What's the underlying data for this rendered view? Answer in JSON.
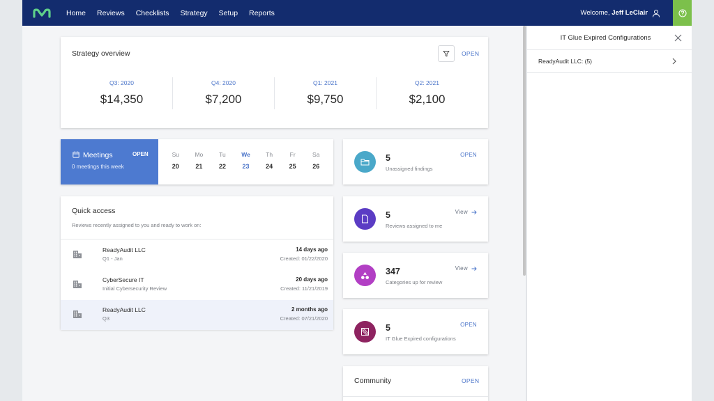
{
  "header": {
    "nav": [
      "Home",
      "Reviews",
      "Checklists",
      "Strategy",
      "Setup",
      "Reports"
    ],
    "welcome_prefix": "Welcome,",
    "user_name": "Jeff LeClair",
    "logo_icon": "m-logo",
    "user_icon": "user-icon",
    "help_icon": "help-circle-icon",
    "brand_color": "#132c6e",
    "help_color": "#7cc04b"
  },
  "strategy": {
    "title": "Strategy overview",
    "open_label": "OPEN",
    "filter_icon": "filter-icon",
    "quarters": [
      {
        "label": "Q3: 2020",
        "value": "$14,350"
      },
      {
        "label": "Q4: 2020",
        "value": "$7,200"
      },
      {
        "label": "Q1: 2021",
        "value": "$9,750"
      },
      {
        "label": "Q2: 2021",
        "value": "$2,100"
      }
    ]
  },
  "meetings": {
    "title": "Meetings",
    "open_label": "OPEN",
    "subtitle": "0 meetings this week",
    "accent": "#4d7ad0",
    "days": [
      {
        "name": "Su",
        "num": "20"
      },
      {
        "name": "Mo",
        "num": "21"
      },
      {
        "name": "Tu",
        "num": "22"
      },
      {
        "name": "We",
        "num": "23"
      },
      {
        "name": "Th",
        "num": "24"
      },
      {
        "name": "Fr",
        "num": "25"
      },
      {
        "name": "Sa",
        "num": "26"
      }
    ],
    "today_index": 3
  },
  "quick_access": {
    "title": "Quick access",
    "description": "Reviews recently assigned to you and ready to work on:",
    "rows": [
      {
        "name": "ReadyAudit LLC",
        "sub": "Q1 - Jan",
        "ago": "14 days ago",
        "created": "Created: 01/22/2020"
      },
      {
        "name": "CyberSecure IT",
        "sub": "Initial Cybersecurity Review",
        "ago": "20 days ago",
        "created": "Created: 11/21/2019"
      },
      {
        "name": "ReadyAudit LLC",
        "sub": "Q3",
        "ago": "2 months ago",
        "created": "Created: 07/21/2020"
      }
    ],
    "selected_index": 2
  },
  "stats": [
    {
      "value": "5",
      "label": "Unassigned findings",
      "link": "OPEN",
      "icon": "folder-icon",
      "color": "#4aa8c9"
    },
    {
      "value": "5",
      "label": "Reviews assigned to me",
      "link": "View",
      "icon": "document-icon",
      "color": "#5b3cc4"
    },
    {
      "value": "347",
      "label": "Categories up for review",
      "link": "View",
      "icon": "categories-icon",
      "color": "#b23fc4"
    },
    {
      "value": "5",
      "label": "IT Glue Expired configurations",
      "link": "OPEN",
      "icon": "it-glue-icon",
      "color": "#8e2360"
    }
  ],
  "community": {
    "title": "Community",
    "open_label": "OPEN"
  },
  "panel": {
    "title": "IT Glue Expired Configurations",
    "item": "ReadyAudit LLC: (5)",
    "close_icon": "close-icon",
    "chevron_icon": "chevron-right-icon"
  }
}
